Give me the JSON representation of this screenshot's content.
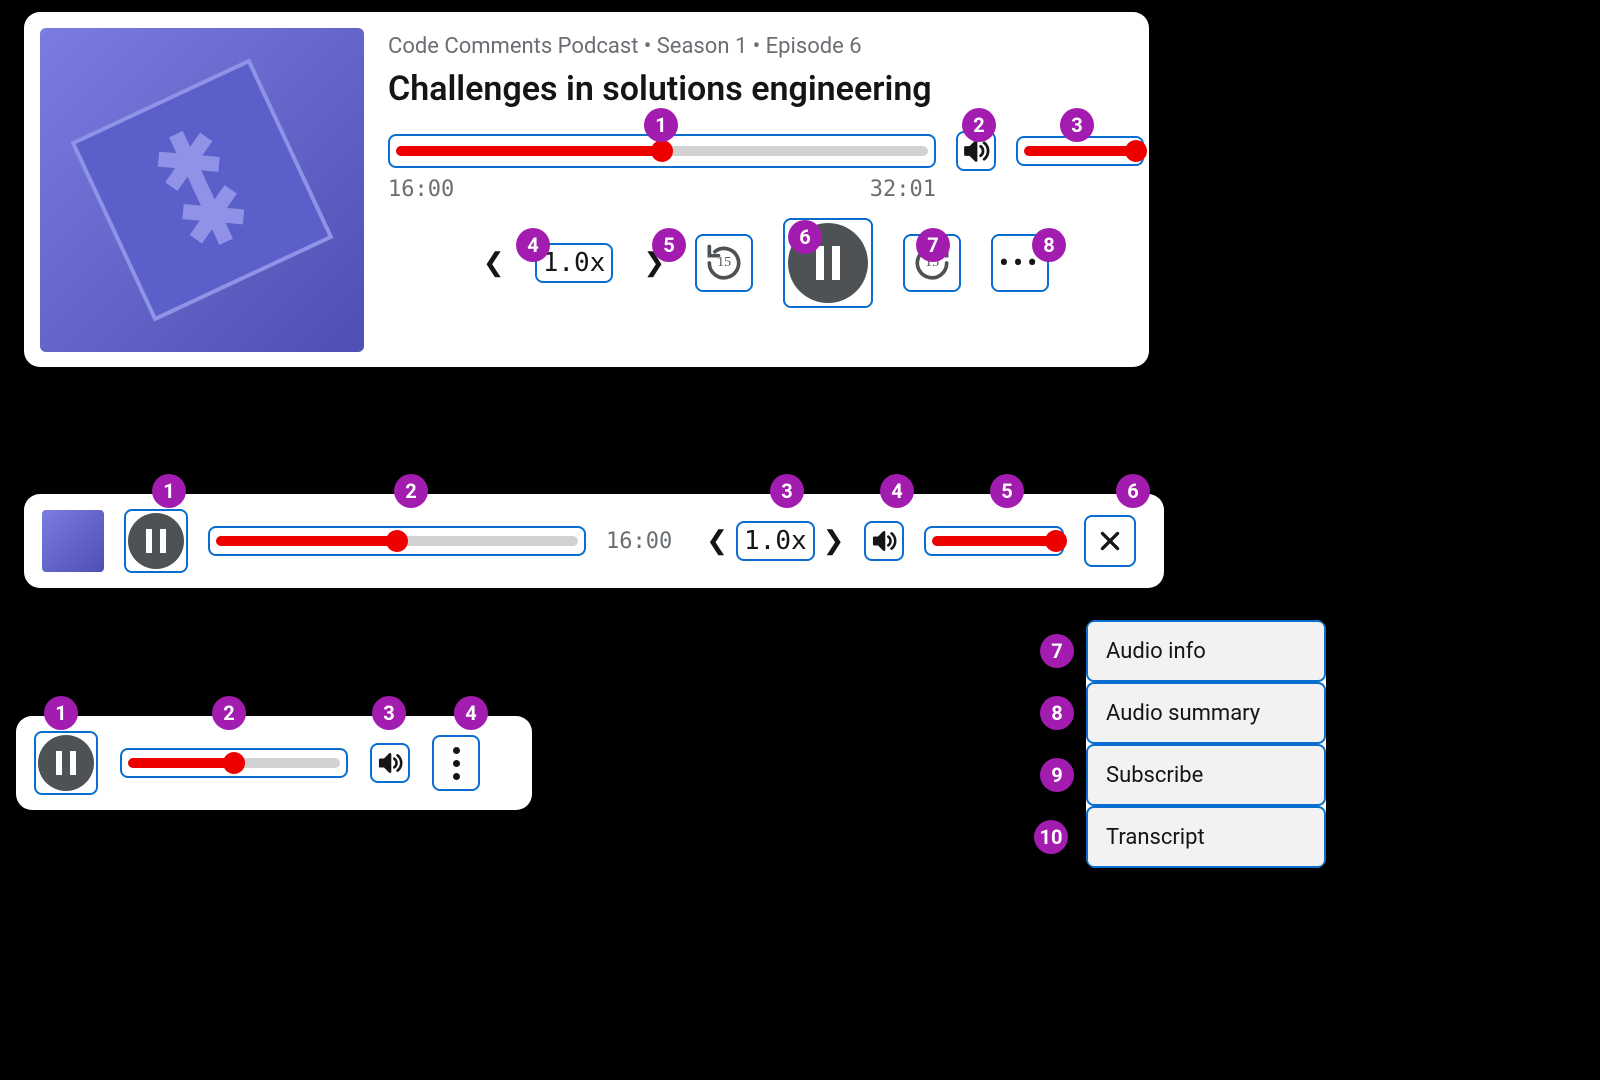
{
  "full": {
    "eyebrow": "Code Comments Podcast • Season 1 • Episode 6",
    "title": "Challenges in solutions engineering",
    "elapsed": "16:00",
    "duration": "32:01",
    "rate": "1.0x",
    "skip_seconds": "15",
    "progress_pct": 50,
    "volume_pct": 95,
    "callouts": {
      "seek": "1",
      "volume_icon": "2",
      "volume_slider": "3",
      "rate": "4",
      "rewind": "5",
      "play": "6",
      "forward": "7",
      "more": "8"
    }
  },
  "bar": {
    "elapsed": "16:00",
    "rate": "1.0x",
    "progress_pct": 50,
    "volume_pct": 95,
    "callouts": {
      "play": "1",
      "seek": "2",
      "rate": "3",
      "volume_icon": "4",
      "volume_slider": "5",
      "close": "6"
    }
  },
  "mini": {
    "progress_pct": 50,
    "callouts": {
      "play": "1",
      "seek": "2",
      "volume_icon": "3",
      "more": "4"
    }
  },
  "menu": {
    "items": [
      "Audio info",
      "Audio summary",
      "Subscribe",
      "Transcript"
    ],
    "callouts": [
      "7",
      "8",
      "9",
      "10"
    ]
  },
  "colors": {
    "accent": "#ee0000",
    "outline": "#0a6ed1",
    "callout": "#a21caf"
  }
}
